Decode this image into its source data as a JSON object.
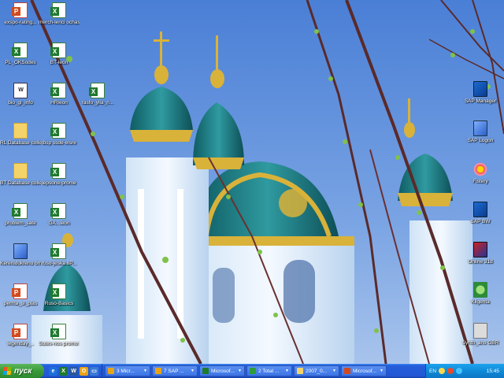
{
  "desktop": {
    "left_icons": [
      {
        "label": "exspo-rating...",
        "type": "ppt"
      },
      {
        "label": "merch-lenci ochast",
        "type": "xls"
      },
      {
        "label": "PL_OKSodes",
        "type": "xls"
      },
      {
        "label": "BT-leon",
        "type": "xls"
      },
      {
        "label": "bio_gl_info",
        "type": "doc"
      },
      {
        "label": "HRleon",
        "type": "xls"
      },
      {
        "label": "rasfo_ylla_n...",
        "type": "xls"
      },
      {
        "label": "RL Database collection",
        "type": "folder"
      },
      {
        "label": "lbsp ssde-elsre",
        "type": "xls"
      },
      {
        "label": "BT Database collection",
        "type": "folder"
      },
      {
        "label": "lepsone-prome",
        "type": "xls"
      },
      {
        "label": "problem_sate",
        "type": "xls"
      },
      {
        "label": "GA...leon",
        "type": "xls"
      },
      {
        "label": "Kerenidokreno ombos.BBP...",
        "type": "exe"
      },
      {
        "label": "ruso-jeska 8P...",
        "type": "xls"
      },
      {
        "label": "perma_sl_plas",
        "type": "ppt"
      },
      {
        "label": "Ruso-Basics",
        "type": "xls"
      },
      {
        "label": "legenday_..",
        "type": "ppt"
      },
      {
        "label": "Sutes-nos promo BO",
        "type": "xls"
      }
    ],
    "right_icons": [
      {
        "label": "SAP Manager",
        "type": "sap"
      },
      {
        "label": "SAP Logon",
        "type": "exe"
      },
      {
        "label": "Fistery",
        "type": "flower"
      },
      {
        "label": "SAP BW",
        "type": "sap"
      },
      {
        "label": "Online 31d",
        "type": "red"
      },
      {
        "label": "Kligenta",
        "type": "green"
      },
      {
        "label": "Synth_ans GBR",
        "type": "gear"
      }
    ]
  },
  "taskbar": {
    "start_label": "пуск",
    "start_flag_colors": [
      "#f25022",
      "#7fba00",
      "#00a4ef",
      "#ffb900"
    ],
    "quick_launch": [
      {
        "icon": "ie-icon",
        "glyph": "e",
        "color": "#1e6fd9"
      },
      {
        "icon": "excel-icon",
        "glyph": "X",
        "color": "#1f7a2e"
      },
      {
        "icon": "word-icon",
        "glyph": "W",
        "color": "#2b579a"
      },
      {
        "icon": "outlook-icon",
        "glyph": "O",
        "color": "#e8a317"
      },
      {
        "icon": "window-icon",
        "glyph": "▭",
        "color": "#3a7bd5"
      }
    ],
    "tasks": [
      {
        "label": "3 Micr...",
        "color": "#e8a317"
      },
      {
        "label": "7 SAP ...",
        "color": "#e8a317"
      },
      {
        "label": "Microsof...",
        "color": "#1f7a2e"
      },
      {
        "label": "2 Total ...",
        "color": "#2e9c3a"
      },
      {
        "label": "2007_0...",
        "color": "#f4d46a"
      },
      {
        "label": "Microsof...",
        "color": "#d24a1e"
      }
    ],
    "tray": {
      "language": "EN",
      "clock": "15:45"
    }
  }
}
